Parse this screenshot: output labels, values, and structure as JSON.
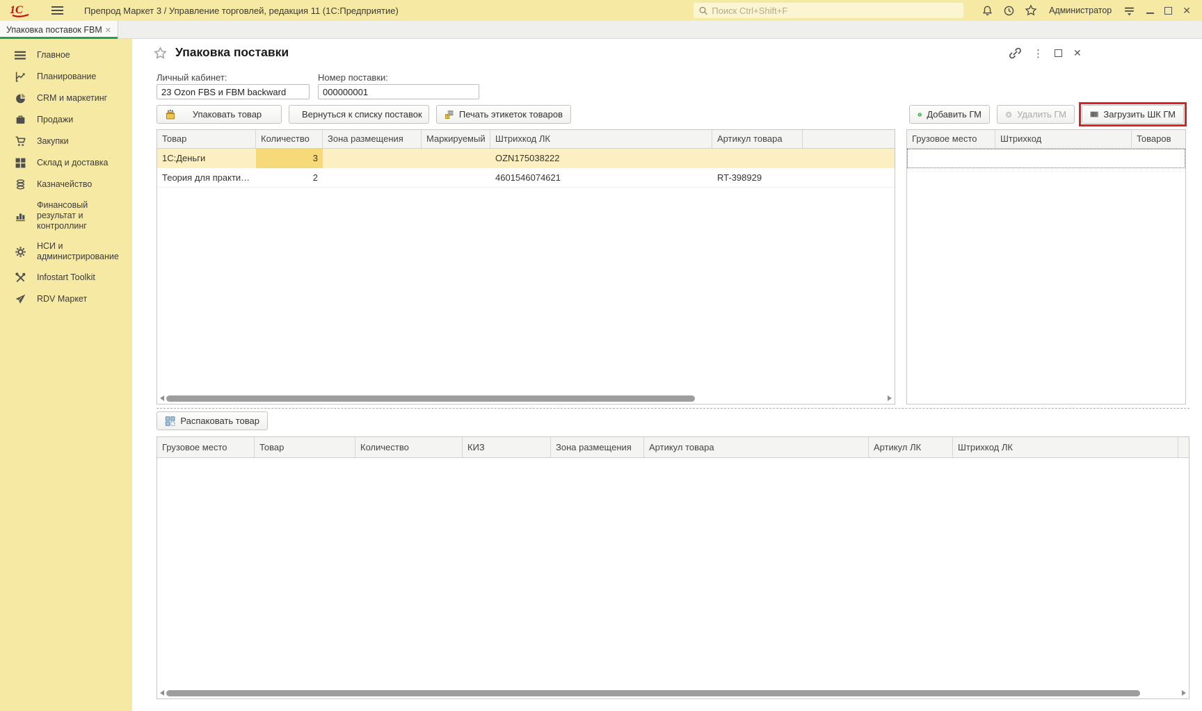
{
  "window": {
    "title": "Препрод Маркет 3 / Управление торговлей, редакция 11  (1С:Предприятие)",
    "search_placeholder": "Поиск Ctrl+Shift+F",
    "user": "Администратор"
  },
  "tab": {
    "label": "Упаковка поставок FBM"
  },
  "sidebar": {
    "items": [
      "Главное",
      "Планирование",
      "CRM и маркетинг",
      "Продажи",
      "Закупки",
      "Склад и доставка",
      "Казначейство",
      "Финансовый результат и контроллинг",
      "НСИ и администрирование",
      "Infostart Toolkit",
      "RDV Маркет"
    ]
  },
  "form": {
    "title": "Упаковка поставки",
    "cabinet": {
      "label": "Личный кабинет:",
      "value": "23 Ozon FBS и FBM backward"
    },
    "supply_number": {
      "label": "Номер поставки:",
      "value": "000000001"
    },
    "actions": {
      "pack": "Упаковать товар",
      "back": "Вернуться к списку поставок",
      "print_labels": "Печать этикеток товаров",
      "add_gm": "Добавить ГМ",
      "delete_gm": "Удалить ГМ",
      "load_barcode_gm": "Загрузить ШК ГМ",
      "unpack": "Распаковать товар"
    }
  },
  "products_table": {
    "headers": [
      "Товар",
      "Количество",
      "Зона размещения",
      "Маркируемый",
      "Штрихкод ЛК",
      "Артикул товара"
    ],
    "rows": [
      {
        "product": "1С:Деньги",
        "qty": "3",
        "zone": "",
        "marked": "",
        "barcode": "OZN175038222",
        "article": ""
      },
      {
        "product": "Теория для практи…",
        "qty": "2",
        "zone": "",
        "marked": "",
        "barcode": "4601546074621",
        "article": "RT-398929"
      }
    ]
  },
  "cargo_table": {
    "headers": [
      "Грузовое место",
      "Штрихкод",
      "Товаров"
    ]
  },
  "packed_table": {
    "headers": [
      "Грузовое место",
      "Товар",
      "Количество",
      "КИЗ",
      "Зона размещения",
      "Артикул товара",
      "Артикул ЛК",
      "Штрихкод ЛК"
    ]
  },
  "icons": {
    "kebab": "⋮",
    "close": "✕",
    "tab_close": "✕"
  },
  "colors": {
    "brand_yellow": "#f6e9a4",
    "accent_green": "#1fa053",
    "highlight_red": "#e3201f",
    "selected_row": "#fcf0c2",
    "active_cell": "#f6d978"
  }
}
